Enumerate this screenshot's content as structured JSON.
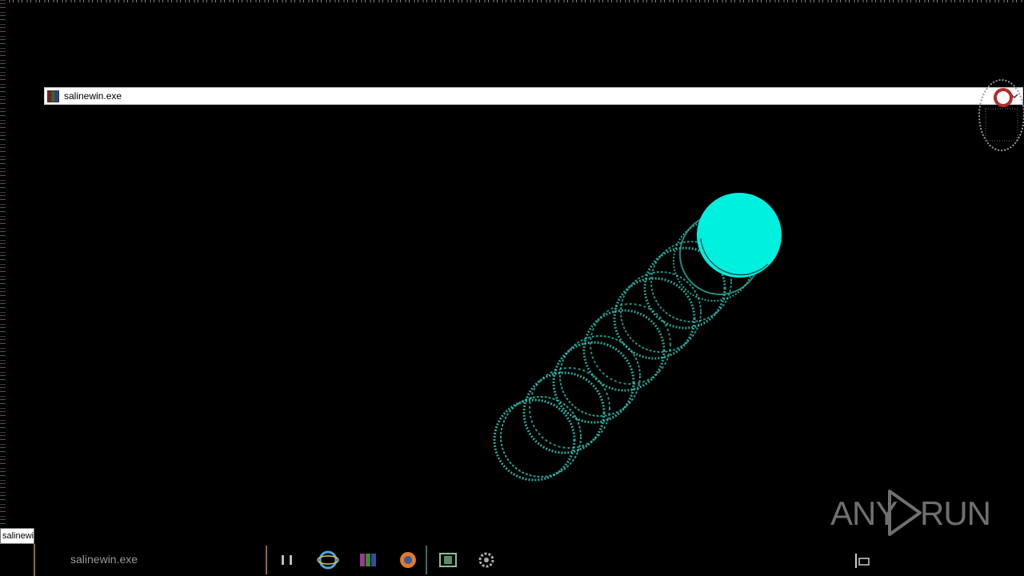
{
  "window": {
    "title": "salinewin.exe",
    "app_icon": "winrar-archive-icon",
    "control_icon": "chevron-down-icon"
  },
  "tooltip": {
    "text": "salinewin.exe"
  },
  "taskbar": {
    "running_app_label": "salinewin.exe",
    "pinned_icons": [
      "file-explorer-icon",
      "internet-explorer-icon",
      "winrar-icon",
      "firefox-icon",
      "media-player-icon",
      "settings-gear-icon"
    ]
  },
  "watermark": {
    "left_text": "ANY",
    "right_text": "RUN",
    "logo_icon": "play-triangle-icon"
  },
  "colors": {
    "background": "#000000",
    "ball": "#00f0e0",
    "trail": "#2fc8b8",
    "watermark": "#6f6f6f"
  }
}
